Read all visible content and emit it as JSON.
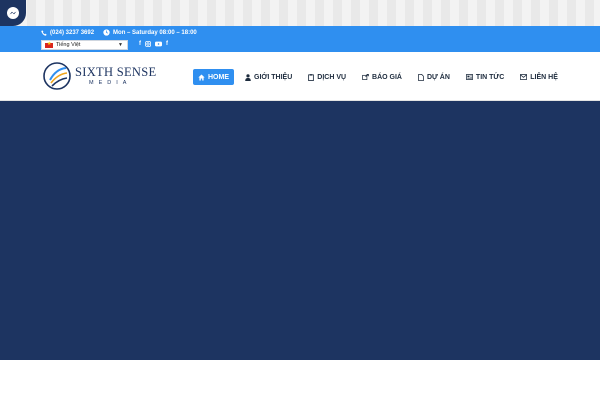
{
  "topbar": {
    "phone": "(024) 3237 3692",
    "hours": "Mon – Saturday 08:00 – 18:00",
    "language": "Tiếng Việt"
  },
  "logo": {
    "name": "SIXTH SENSE",
    "sub": "MEDIA"
  },
  "nav": [
    {
      "label": "HOME",
      "icon": "home-icon",
      "active": true
    },
    {
      "label": "GIỚI THIỆU",
      "icon": "user-icon"
    },
    {
      "label": "DỊCH VỤ",
      "icon": "clipboard-icon"
    },
    {
      "label": "BÁO GIÁ",
      "icon": "external-icon"
    },
    {
      "label": "DỰ ÁN",
      "icon": "document-icon"
    },
    {
      "label": "TIN TỨC",
      "icon": "newspaper-icon"
    },
    {
      "label": "LIÊN HỆ",
      "icon": "envelope-icon"
    }
  ],
  "colors": {
    "accent": "#2f8ff0",
    "brand": "#1d3461"
  }
}
